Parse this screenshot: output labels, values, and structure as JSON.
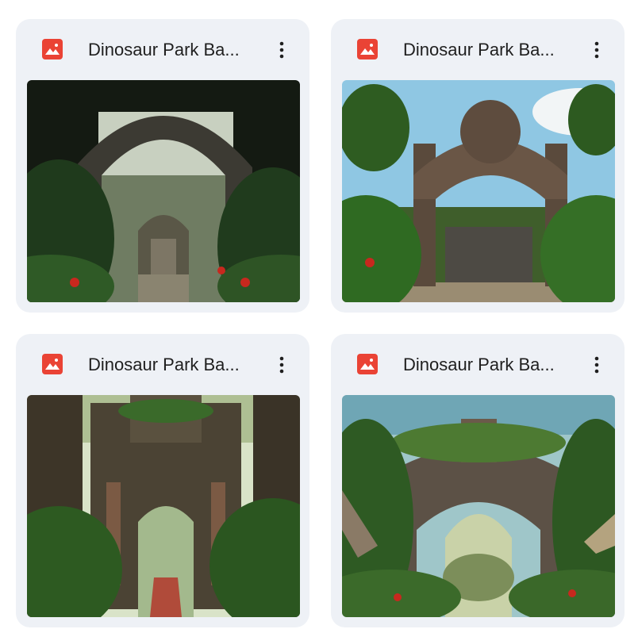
{
  "files": [
    {
      "name": "Dinosaur Park Ba...",
      "icon": "image-file-icon",
      "menu_icon": "more-vert-icon"
    },
    {
      "name": "Dinosaur Park Ba...",
      "icon": "image-file-icon",
      "menu_icon": "more-vert-icon"
    },
    {
      "name": "Dinosaur Park Ba...",
      "icon": "image-file-icon",
      "menu_icon": "more-vert-icon"
    },
    {
      "name": "Dinosaur Park Ba...",
      "icon": "image-file-icon",
      "menu_icon": "more-vert-icon"
    }
  ],
  "colors": {
    "card_bg": "#eef1f6",
    "icon_red": "#ea4335",
    "text": "#1f1f1f"
  }
}
